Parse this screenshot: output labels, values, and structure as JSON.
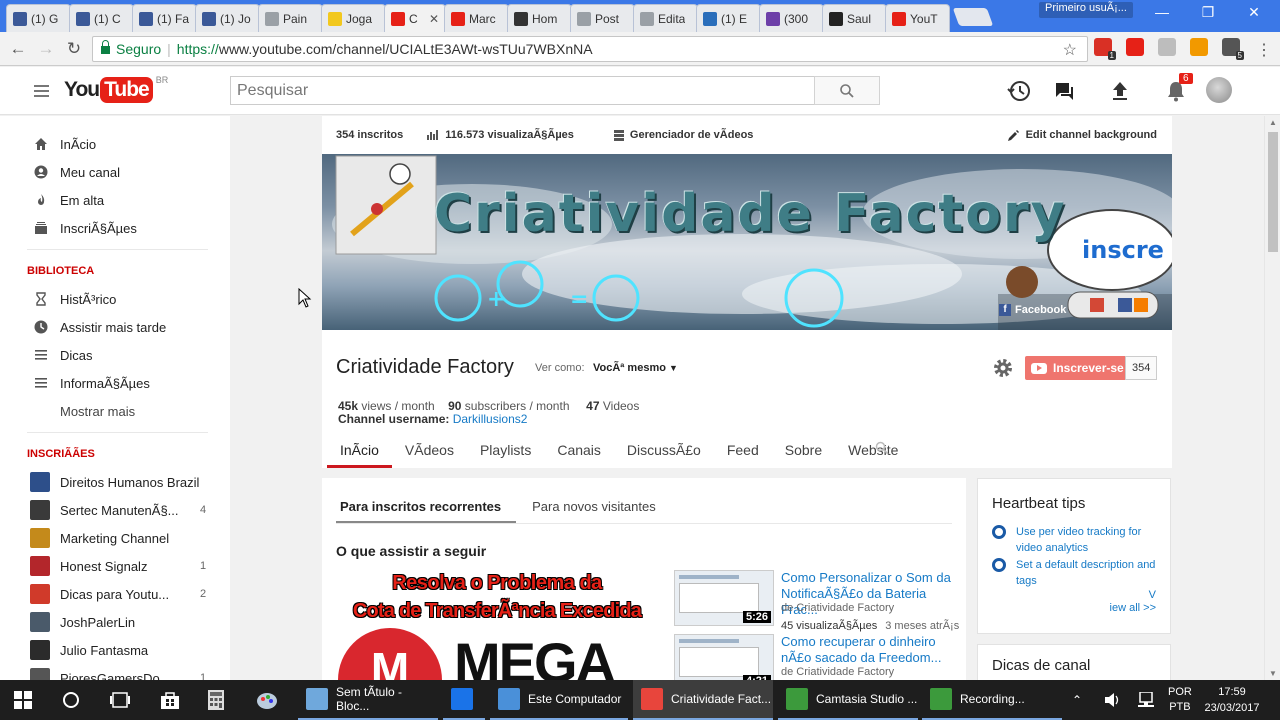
{
  "browser": {
    "tabs": [
      {
        "label": "(1) G",
        "favicon": "facebook-icon",
        "color": "#3b5998"
      },
      {
        "label": "(1) C",
        "favicon": "facebook-icon",
        "color": "#3b5998"
      },
      {
        "label": "(1) Fa",
        "favicon": "facebook-icon",
        "color": "#3b5998"
      },
      {
        "label": "(1) Jo",
        "favicon": "facebook-icon",
        "color": "#3b5998"
      },
      {
        "label": "Pain",
        "favicon": "document-icon",
        "color": "#9aa0a6"
      },
      {
        "label": "Joga",
        "favicon": "game-icon",
        "color": "#f2c81e"
      },
      {
        "label": "C",
        "favicon": "youtube-icon",
        "color": "#e62117",
        "active": true
      },
      {
        "label": "Marc",
        "favicon": "youtube-icon",
        "color": "#e62117"
      },
      {
        "label": "Hom",
        "favicon": "hub-icon",
        "color": "#333333"
      },
      {
        "label": "Post",
        "favicon": "document-icon",
        "color": "#9aa0a6"
      },
      {
        "label": "Edita",
        "favicon": "document-icon",
        "color": "#9aa0a6"
      },
      {
        "label": "(1) E",
        "favicon": "check-icon",
        "color": "#2a6ebb"
      },
      {
        "label": "(300",
        "favicon": "mail-icon",
        "color": "#6d3fa8"
      },
      {
        "label": "Saul",
        "favicon": "fb-dark-icon",
        "color": "#222222"
      },
      {
        "label": "YouT",
        "favicon": "youtube-icon",
        "color": "#e62117"
      }
    ],
    "profile_chip": "Primeiro usuÃ¡...",
    "url_secure_label": "Seguro",
    "url_scheme": "https://",
    "url_rest": "www.youtube.com/channel/UCIALtE3AWt-wsTUu7WBXnNA",
    "extensions": [
      {
        "name": "ext-badge-icon",
        "badge": "1",
        "color": "#d93025"
      },
      {
        "name": "heart-icon",
        "badge": "",
        "color": "#e62117"
      },
      {
        "name": "cast-icon",
        "badge": "",
        "color": "#bdbdbd"
      },
      {
        "name": "color-drop-icon",
        "badge": "",
        "color": "#f29900"
      },
      {
        "name": "bug-icon",
        "badge": "5",
        "color": "#555555"
      }
    ]
  },
  "youtube": {
    "logo_you": "You",
    "logo_tube": "Tube",
    "logo_country": "BR",
    "search_placeholder": "Pesquisar",
    "notifications_count": "6",
    "guide": {
      "main": [
        {
          "label": "InÃ­cio",
          "icon": "home-icon"
        },
        {
          "label": "Meu canal",
          "icon": "account-icon"
        },
        {
          "label": "Em alta",
          "icon": "flame-icon"
        },
        {
          "label": "InscriÃ§Ãµes",
          "icon": "subscriptions-icon"
        }
      ],
      "library_heading": "BIBLIOTECA",
      "library": [
        {
          "label": "HistÃ³rico",
          "icon": "hourglass-icon"
        },
        {
          "label": "Assistir mais tarde",
          "icon": "clock-icon"
        },
        {
          "label": "Dicas",
          "icon": "playlist-icon"
        },
        {
          "label": "InformaÃ§Ãµes",
          "icon": "playlist-icon"
        }
      ],
      "show_more": "Mostrar mais",
      "subs_heading": "INSCRIÃÃES",
      "subscriptions": [
        {
          "label": "Direitos Humanos Brazil",
          "count": "",
          "color": "#2d4f8a"
        },
        {
          "label": "Sertec ManutenÃ§...",
          "count": "4",
          "color": "#3a3a3a"
        },
        {
          "label": "Marketing Channel",
          "count": "",
          "color": "#c48a1b"
        },
        {
          "label": "Honest Signalz",
          "count": "1",
          "color": "#b3262b"
        },
        {
          "label": "Dicas para Youtu...",
          "count": "2",
          "color": "#d03a2a"
        },
        {
          "label": "JoshPalerLin",
          "count": "",
          "color": "#4a5a6a"
        },
        {
          "label": "Julio Fantasma",
          "count": "",
          "color": "#2b2b2b"
        },
        {
          "label": "PioresGamersDo...",
          "count": "1",
          "color": "#555555"
        }
      ]
    },
    "channel": {
      "subscribers_stat": "354 inscritos",
      "views_stat": "116.573 visualizaÃ§Ãµes",
      "video_manager": "Gerenciador de vÃ­deos",
      "edit_background": "Edit channel background",
      "banner": {
        "title": "Criatividade Factory",
        "subscribe_bubble": "inscre",
        "facebook": "Facebook"
      },
      "name": "Criatividade Factory",
      "view_as_label": "Ver como:",
      "view_as_value": "VocÃª mesmo",
      "subscribe_label": "Inscrever-se",
      "subscribe_count": "354",
      "views_per_month": "45k",
      "views_per_month_label": "views / month",
      "subs_per_month": "90",
      "subs_per_month_label": "subscribers / month",
      "videos_count": "47",
      "videos_label": "Videos",
      "username_label": "Channel username:",
      "username": "Darkillusions2",
      "tabs": [
        "InÃ­cio",
        "VÃ­deos",
        "Playlists",
        "Canais",
        "DiscussÃ£o",
        "Feed",
        "Sobre",
        "Website"
      ]
    },
    "content": {
      "tabs": [
        "Para inscritos recorrentes",
        "Para novos visitantes"
      ],
      "section_title": "O que assistir a seguir",
      "featured_thumb": {
        "line1": "Resolva o Problema da",
        "line2": "Cota de TransferÃªncia Excedida",
        "brand": "MEGA",
        "brand_letter": "M"
      },
      "videos": [
        {
          "title": "Como Personalizar o Som da NotificaÃ§Ã£o da Bateria Frac...",
          "by": "de Criatividade Factory",
          "views": "45 visualizaÃ§Ãµes",
          "age": "3 meses atrÃ¡s",
          "duration": "5:26"
        },
        {
          "title": "Como recuperar o dinheiro nÃ£o sacado da Freedom...",
          "by": "de Criatividade Factory",
          "views": "",
          "age": "",
          "duration": "4:21"
        }
      ]
    },
    "heartbeat": {
      "title": "Heartbeat tips",
      "items": [
        "Use per video tracking for video analytics",
        "Set a default description and tags"
      ],
      "view_all_line1": "V",
      "view_all_line2": "iew all >>"
    },
    "channel_tips_title": "Dicas de canal"
  },
  "taskbar": {
    "windows": [
      {
        "label": "Sem tÃ­tulo - Bloc...",
        "icon": "notepad-icon",
        "color": "#6fa8dc"
      },
      {
        "label": "",
        "icon": "ie-icon",
        "color": "#1a73e8"
      },
      {
        "label": "Este Computador",
        "icon": "computer-icon",
        "color": "#4a90d9"
      },
      {
        "label": "Criatividade Fact...",
        "icon": "chrome-icon",
        "color": "#e8453c",
        "active": true
      },
      {
        "label": "Camtasia Studio ...",
        "icon": "camtasia-icon",
        "color": "#3c9a3c"
      },
      {
        "label": "Recording...",
        "icon": "recording-icon",
        "color": "#3c9a3c"
      }
    ],
    "lang_line1": "POR",
    "lang_line2": "PTB",
    "time": "17:59",
    "date": "23/03/2017"
  }
}
